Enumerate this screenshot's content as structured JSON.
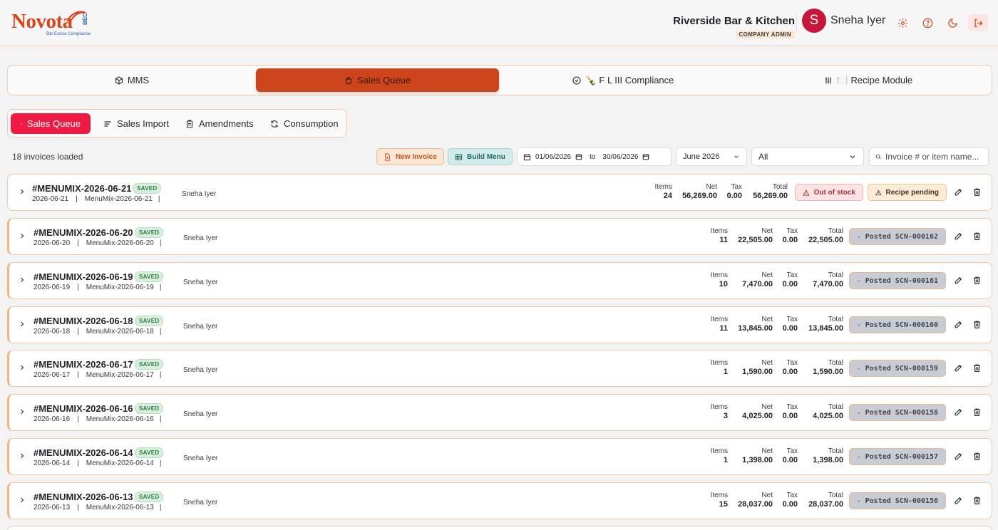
{
  "brand": {
    "name": "Novota",
    "suffix": "BEC",
    "tagline": "Bar Excise Compliance",
    "accent": "#d9441a"
  },
  "header": {
    "company": "Riverside Bar & Kitchen",
    "role": "COMPANY ADMIN",
    "avatar_initial": "S",
    "user": "Sneha Iyer",
    "icons": [
      "gear-icon",
      "help-icon",
      "moon-icon",
      "logout-icon"
    ]
  },
  "main_tabs": [
    {
      "label": "MMS",
      "icon": "box-icon"
    },
    {
      "label": "Sales Queue",
      "icon": "bag-icon",
      "active": true
    },
    {
      "label": "🍾 F L III Compliance",
      "icon": "check-circle-icon"
    },
    {
      "label": "🍽️ Recipe Module",
      "icon": "sliders-icon"
    }
  ],
  "sub_tabs": [
    {
      "label": "Sales Queue",
      "icon": "bag-icon",
      "active": true
    },
    {
      "label": "Sales Import",
      "icon": "list-icon"
    },
    {
      "label": "Amendments",
      "icon": "clipboard-icon"
    },
    {
      "label": "Consumption",
      "icon": "refresh-icon"
    }
  ],
  "toolbar": {
    "count_text": "18 invoices loaded",
    "new_invoice": "New Invoice",
    "build_menu": "Build Menu",
    "date_from": "01/06/2026",
    "date_to_sep": "to",
    "date_to": "30/06/2026",
    "month": "June 2026",
    "filter": "All",
    "search_placeholder": "Invoice # or item name..."
  },
  "labels": {
    "saved": "SAVED",
    "items": "Items",
    "net": "Net",
    "tax": "Tax",
    "total": "Total",
    "out_of_stock": "Out of stock",
    "recipe_pending": "Recipe pending"
  },
  "invoices": [
    {
      "title": "#MENUMIX-2026-06-21",
      "date": "2026-06-21",
      "ref": "MenuMix-2026-06-21",
      "user": "Sneha Iyer",
      "items": "24",
      "net": "56,269.00",
      "tax": "0.00",
      "total": "56,269.00",
      "status": "pending"
    },
    {
      "title": "#MENUMIX-2026-06-20",
      "date": "2026-06-20",
      "ref": "MenuMix-2026-06-20",
      "user": "Sneha Iyer",
      "items": "11",
      "net": "22,505.00",
      "tax": "0.00",
      "total": "22,505.00",
      "status": "posted",
      "posted": "Posted SCN-000162"
    },
    {
      "title": "#MENUMIX-2026-06-19",
      "date": "2026-06-19",
      "ref": "MenuMix-2026-06-19",
      "user": "Sneha Iyer",
      "items": "10",
      "net": "7,470.00",
      "tax": "0.00",
      "total": "7,470.00",
      "status": "posted",
      "posted": "Posted SCN-000161"
    },
    {
      "title": "#MENUMIX-2026-06-18",
      "date": "2026-06-18",
      "ref": "MenuMix-2026-06-18",
      "user": "Sneha Iyer",
      "items": "11",
      "net": "13,845.00",
      "tax": "0.00",
      "total": "13,845.00",
      "status": "posted",
      "posted": "Posted SCN-000160"
    },
    {
      "title": "#MENUMIX-2026-06-17",
      "date": "2026-06-17",
      "ref": "MenuMix-2026-06-17",
      "user": "Sneha Iyer",
      "items": "1",
      "net": "1,590.00",
      "tax": "0.00",
      "total": "1,590.00",
      "status": "posted",
      "posted": "Posted SCN-000159"
    },
    {
      "title": "#MENUMIX-2026-06-16",
      "date": "2026-06-16",
      "ref": "MenuMix-2026-06-16",
      "user": "Sneha Iyer",
      "items": "3",
      "net": "4,025.00",
      "tax": "0.00",
      "total": "4,025.00",
      "status": "posted",
      "posted": "Posted SCN-000158"
    },
    {
      "title": "#MENUMIX-2026-06-14",
      "date": "2026-06-14",
      "ref": "MenuMix-2026-06-14",
      "user": "Sneha Iyer",
      "items": "1",
      "net": "1,398.00",
      "tax": "0.00",
      "total": "1,398.00",
      "status": "posted",
      "posted": "Posted SCN-000157"
    },
    {
      "title": "#MENUMIX-2026-06-13",
      "date": "2026-06-13",
      "ref": "MenuMix-2026-06-13",
      "user": "Sneha Iyer",
      "items": "15",
      "net": "28,037.00",
      "tax": "0.00",
      "total": "28,037.00",
      "status": "posted",
      "posted": "Posted SCN-000156"
    }
  ]
}
